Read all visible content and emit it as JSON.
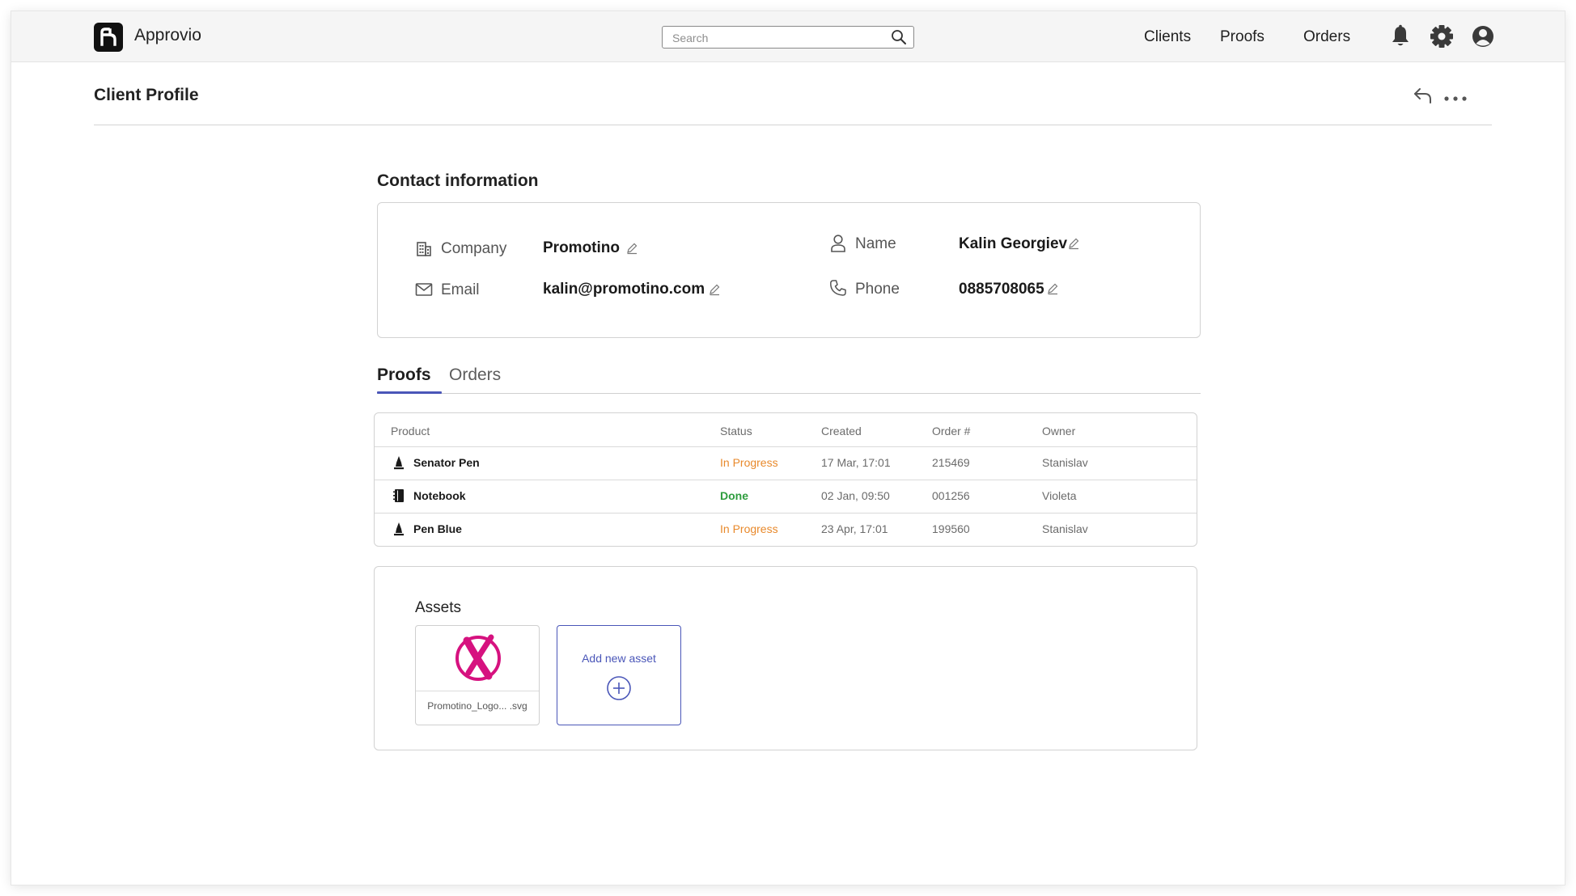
{
  "app": {
    "name": "Approvio"
  },
  "search": {
    "placeholder": "Search"
  },
  "nav": {
    "items": [
      "Clients",
      "Proofs",
      "Orders"
    ]
  },
  "page": {
    "title": "Client Profile"
  },
  "contact": {
    "title": "Contact information",
    "company": {
      "label": "Company",
      "value": "Promotino"
    },
    "email": {
      "label": "Email",
      "value": "kalin@promotino.com"
    },
    "name": {
      "label": "Name",
      "value": "Kalin Georgiev"
    },
    "phone": {
      "label": "Phone",
      "value": "0885708065"
    }
  },
  "tabs": [
    {
      "label": "Proofs",
      "active": true
    },
    {
      "label": "Orders",
      "active": false
    }
  ],
  "table": {
    "columns": [
      "Product",
      "Status",
      "Created",
      "Order #",
      "Owner"
    ],
    "rows": [
      {
        "icon": "pen-icon",
        "product": "Senator Pen",
        "status": "In Progress",
        "created": "17 Mar, 17:01",
        "order": "215469",
        "owner": "Stanislav"
      },
      {
        "icon": "notebook-icon",
        "product": "Notebook",
        "status": "Done",
        "created": "02 Jan, 09:50",
        "order": "001256",
        "owner": "Violeta"
      },
      {
        "icon": "pen-icon",
        "product": "Pen Blue",
        "status": "In Progress",
        "created": "23 Apr, 17:01",
        "order": "199560",
        "owner": "Stanislav"
      }
    ]
  },
  "assets": {
    "title": "Assets",
    "items": [
      {
        "name": "Promotino_Logo... .svg"
      }
    ],
    "add_label": "Add new asset"
  },
  "colors": {
    "accent": "#4a56b8",
    "in_progress": "#e8892b",
    "done": "#2e9d3e",
    "logo_magenta": "#d6127f"
  }
}
